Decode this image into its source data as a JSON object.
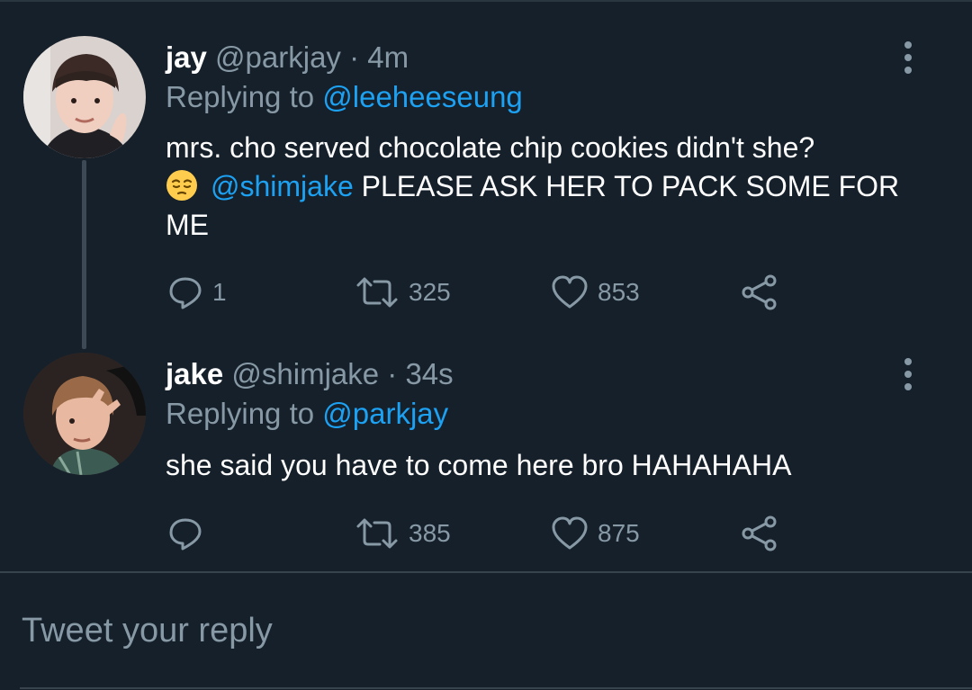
{
  "tweets": [
    {
      "name": "jay",
      "handle": "@parkjay",
      "time": "· 4m",
      "replying_prefix": "Replying to ",
      "replying_to": "@leeheeseung",
      "body_line1": "mrs. cho served chocolate chip cookies didn't she?",
      "emoji_icon": "pensive-face-emoji",
      "mention": "@shimjake",
      "body_rest": " PLEASE ASK HER TO PACK SOME FOR ME",
      "replies": "1",
      "retweets": "325",
      "likes": "853"
    },
    {
      "name": "jake",
      "handle": "@shimjake",
      "time": "· 34s",
      "replying_prefix": "Replying to ",
      "replying_to": "@parkjay",
      "body": "she said you have to come here bro HAHAHAHA",
      "replies": "",
      "retweets": "385",
      "likes": "875"
    }
  ],
  "composer": {
    "placeholder": "Tweet your reply"
  },
  "icons": [
    "more-vertical-icon",
    "reply-icon",
    "retweet-icon",
    "like-icon",
    "share-icon"
  ],
  "colors": {
    "background": "#15202b",
    "accent": "#1da1f2",
    "muted": "#8899a6"
  }
}
